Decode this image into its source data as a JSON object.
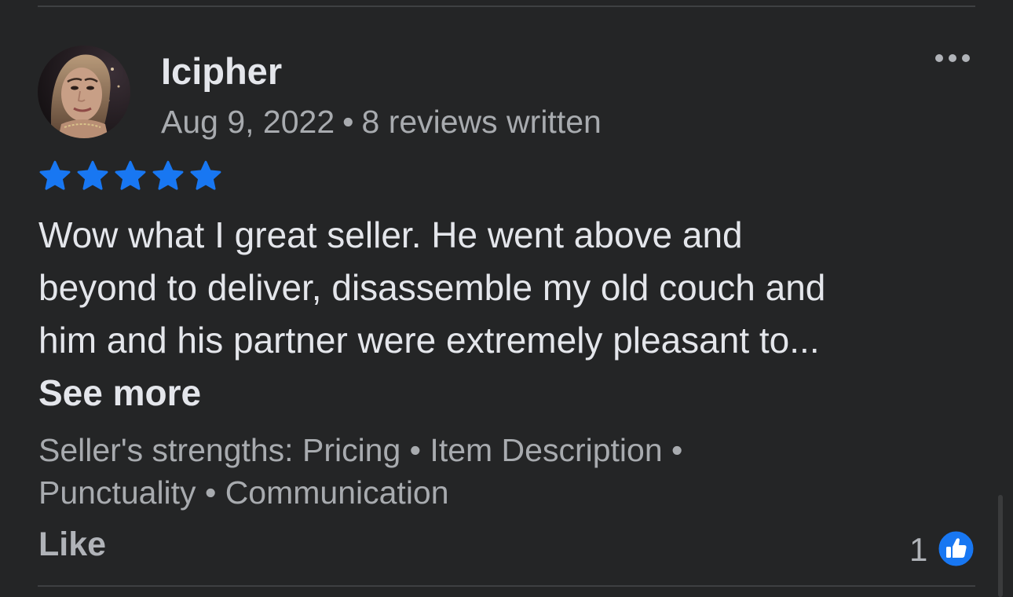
{
  "review": {
    "reviewer_name": "Icipher",
    "date": "Aug 9, 2022",
    "meta_separator": "•",
    "reviews_written": "8 reviews written",
    "rating": 5,
    "rating_max": 5,
    "text_lines": [
      "Wow what I great seller. He went above and",
      "beyond to deliver, disassemble my old couch and",
      "him and his partner were extremely pleasant to..."
    ],
    "see_more_label": "See more",
    "strengths_line1": "Seller's strengths: Pricing • Item Description •",
    "strengths_line2": "Punctuality • Communication",
    "like_label": "Like",
    "like_count": "1"
  },
  "colors": {
    "background": "#242526",
    "primary_text": "#e4e6eb",
    "secondary_text": "#a8abaf",
    "accent_blue": "#1877f2",
    "divider": "#3e4042"
  },
  "icons": {
    "more": "more-horizontal-icon",
    "star": "star-icon",
    "like_badge": "thumbs-up-icon"
  }
}
